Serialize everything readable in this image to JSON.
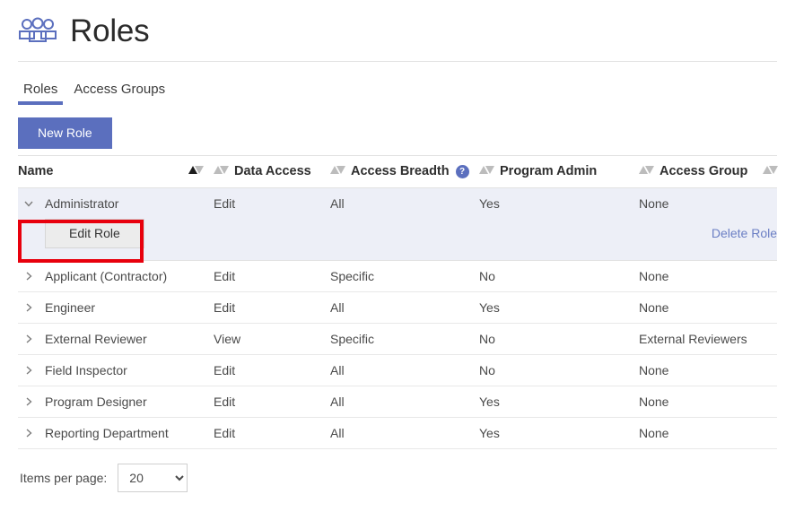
{
  "header": {
    "title": "Roles",
    "icon": "people-group-icon"
  },
  "tabs": [
    {
      "label": "Roles",
      "active": true
    },
    {
      "label": "Access Groups",
      "active": false
    }
  ],
  "toolbar": {
    "new_role_label": "New Role"
  },
  "table": {
    "columns": [
      {
        "label": "Name",
        "sort": "asc"
      },
      {
        "label": "Data Access",
        "sort": "none"
      },
      {
        "label": "Access Breadth",
        "sort": "none",
        "help": "?"
      },
      {
        "label": "Program Admin",
        "sort": "none"
      },
      {
        "label": "Access Group",
        "sort": "none"
      }
    ],
    "rows": [
      {
        "name": "Administrator",
        "data_access": "Edit",
        "access_breadth": "All",
        "program_admin": "Yes",
        "access_group": "None",
        "expanded": true,
        "chevron": "chevron-down-icon",
        "edit_label": "Edit Role",
        "delete_label": "Delete Role"
      },
      {
        "name": "Applicant (Contractor)",
        "data_access": "Edit",
        "access_breadth": "Specific",
        "program_admin": "No",
        "access_group": "None",
        "expanded": false,
        "chevron": "chevron-right-icon"
      },
      {
        "name": "Engineer",
        "data_access": "Edit",
        "access_breadth": "All",
        "program_admin": "Yes",
        "access_group": "None",
        "expanded": false,
        "chevron": "chevron-right-icon"
      },
      {
        "name": "External Reviewer",
        "data_access": "View",
        "access_breadth": "Specific",
        "program_admin": "No",
        "access_group": "External Reviewers",
        "expanded": false,
        "chevron": "chevron-right-icon"
      },
      {
        "name": "Field Inspector",
        "data_access": "Edit",
        "access_breadth": "All",
        "program_admin": "No",
        "access_group": "None",
        "expanded": false,
        "chevron": "chevron-right-icon"
      },
      {
        "name": "Program Designer",
        "data_access": "Edit",
        "access_breadth": "All",
        "program_admin": "Yes",
        "access_group": "None",
        "expanded": false,
        "chevron": "chevron-right-icon"
      },
      {
        "name": "Reporting Department",
        "data_access": "Edit",
        "access_breadth": "All",
        "program_admin": "Yes",
        "access_group": "None",
        "expanded": false,
        "chevron": "chevron-right-icon"
      }
    ]
  },
  "footer": {
    "items_per_page_label": "Items per page:",
    "items_per_page_value": "20",
    "items_per_page_options": [
      "20"
    ]
  },
  "annotation": {
    "target": "edit-role-button",
    "color": "#e8000d"
  },
  "colors": {
    "accent": "#5b6fbe",
    "expanded_row_bg": "#edeff7",
    "link": "#6b7fc4",
    "annotation": "#e8000d"
  }
}
